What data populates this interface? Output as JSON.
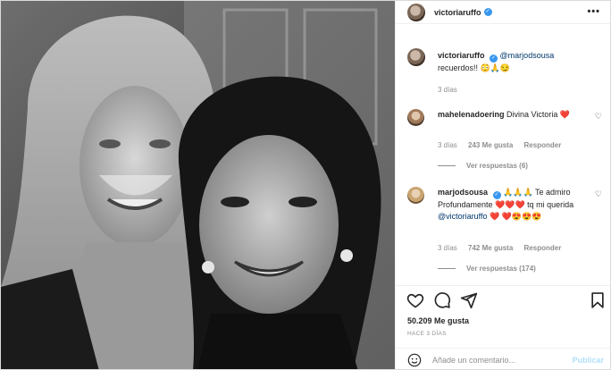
{
  "post": {
    "username": "victoriaruffo",
    "more_label": "•••"
  },
  "caption": {
    "username": "victoriaruffo",
    "mention": "@marjodsousa",
    "text": "recuerdos!! 😳🙏😏",
    "time": "3 días"
  },
  "comments": [
    {
      "username": "mahelenadoering",
      "text": "Divina Victoria ❤️",
      "time": "3 días",
      "likes": "243 Me gusta",
      "reply": "Responder",
      "view_replies": "Ver respuestas (6)"
    },
    {
      "username": "marjodsousa",
      "text_part1": "🙏🙏🙏 Te admiro Profundamente ❤️❤️❤️ tq mi querida",
      "mention": "@victoriaruffo",
      "text_part2": "❤️ ❤️😍😍😍",
      "time": "3 días",
      "likes": "742 Me gusta",
      "reply": "Responder",
      "view_replies": "Ver respuestas (174)"
    }
  ],
  "stats": {
    "likes": "50.209 Me gusta",
    "date": "HACE 3 DÍAS"
  },
  "composer": {
    "placeholder": "Añade un comentario...",
    "publish_label": "Publicar"
  },
  "icons": {
    "like": "heart-icon",
    "comment": "comment-icon",
    "share": "share-icon",
    "save": "bookmark-icon",
    "emoji": "emoji-icon",
    "verified": "verified-badge-icon"
  },
  "colors": {
    "verified": "#3897f0",
    "mention": "#00376b",
    "heart": "#ed4956",
    "publish_disabled": "#b2dffc",
    "muted": "#8e8e8e"
  }
}
